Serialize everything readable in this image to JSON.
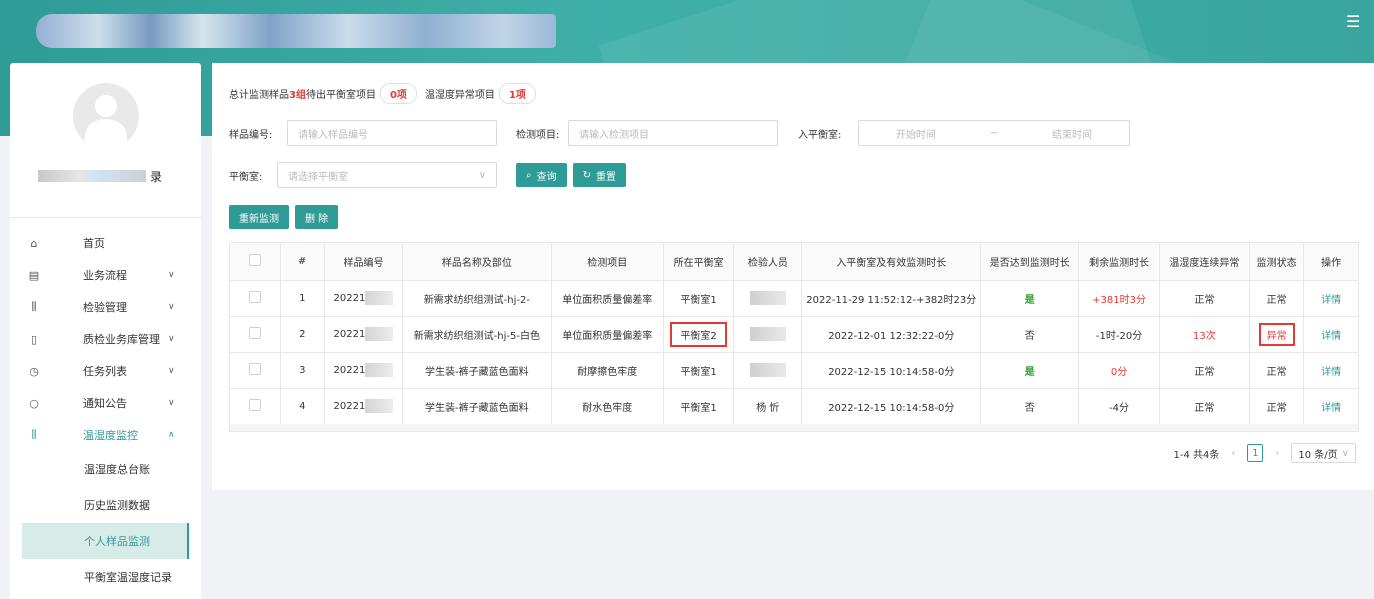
{
  "header": {
    "menu_icon": "menu-list-icon"
  },
  "sidebar": {
    "username_tail": "录",
    "nav": [
      {
        "icon": "⌂",
        "label": "首页",
        "chevron": ""
      },
      {
        "icon": "▤",
        "label": "业务流程",
        "chevron": "∨"
      },
      {
        "icon": "⫼",
        "label": "检验管理",
        "chevron": "∨"
      },
      {
        "icon": "▯",
        "label": "质检业务库管理",
        "chevron": "∨"
      },
      {
        "icon": "◷",
        "label": "任务列表",
        "chevron": "∨"
      },
      {
        "icon": "○",
        "label": "通知公告",
        "chevron": "∨"
      },
      {
        "icon": "⫼",
        "label": "温湿度监控",
        "chevron": "∧"
      }
    ],
    "sub": [
      {
        "label": "温湿度总台账"
      },
      {
        "label": "历史监测数据"
      },
      {
        "label": "个人样品监测"
      },
      {
        "label": "平衡室温湿度记录"
      }
    ]
  },
  "summary": {
    "total_label": "总计监测样品",
    "total_value": "3组",
    "pending_label": "待出平衡室项目",
    "pending_value": "0项",
    "abnormal_label": "温湿度异常项目",
    "abnormal_value": "1项"
  },
  "filters": {
    "sample_no_label": "样品编号:",
    "sample_no_placeholder": "请输入样品编号",
    "test_item_label": "检测项目:",
    "test_item_placeholder": "请输入检测项目",
    "enter_room_label": "入平衡室:",
    "start_placeholder": "开始时间",
    "range_sep": "~",
    "end_placeholder": "结束时间",
    "room_label": "平衡室:",
    "room_placeholder": "请选择平衡室",
    "query_label": "查询",
    "reset_label": "重置"
  },
  "actions": {
    "remonitor_label": "重新监测",
    "delete_label": "删 除"
  },
  "table": {
    "headers": [
      "",
      "#",
      "样品编号",
      "样品名称及部位",
      "检测项目",
      "所在平衡室",
      "检验人员",
      "入平衡室及有效监测时长",
      "是否达到监测时长",
      "剩余监测时长",
      "温湿度连续异常",
      "监测状态",
      "操作"
    ],
    "rows": [
      {
        "idx": "1",
        "code": "20221",
        "name": "新需求纺织组测试-hj-2-",
        "item": "单位面积质量偏差率",
        "room": "平衡室1",
        "inspector": "",
        "time": "2022-11-29 11:52:12-+382时23分",
        "reached": "是",
        "remaining": "+381时3分",
        "abnormal": "正常",
        "status": "正常",
        "op": "详情"
      },
      {
        "idx": "2",
        "code": "20221",
        "name": "新需求纺织组测试-hj-5-白色",
        "item": "单位面积质量偏差率",
        "room": "平衡室2",
        "inspector": "",
        "time": "2022-12-01 12:32:22-0分",
        "reached": "否",
        "remaining": "-1时-20分",
        "abnormal": "13次",
        "status": "异常",
        "op": "详情"
      },
      {
        "idx": "3",
        "code": "20221",
        "name": "学生装-裤子藏蓝色面料",
        "item": "耐摩擦色牢度",
        "room": "平衡室1",
        "inspector": "",
        "time": "2022-12-15 10:14:58-0分",
        "reached": "是",
        "remaining": "0分",
        "abnormal": "正常",
        "status": "正常",
        "op": "详情"
      },
      {
        "idx": "4",
        "code": "20221",
        "name": "学生装-裤子藏蓝色面料",
        "item": "耐水色牢度",
        "room": "平衡室1",
        "inspector": "杨 忻",
        "time": "2022-12-15 10:14:58-0分",
        "reached": "否",
        "remaining": "-4分",
        "abnormal": "正常",
        "status": "正常",
        "op": "详情"
      }
    ]
  },
  "pagination": {
    "summary": "1-4 共4条",
    "page": "1",
    "size": "10 条/页"
  },
  "colors": {
    "accent": "#2f9b97",
    "danger": "#e53935",
    "success": "#2e9f2e"
  }
}
